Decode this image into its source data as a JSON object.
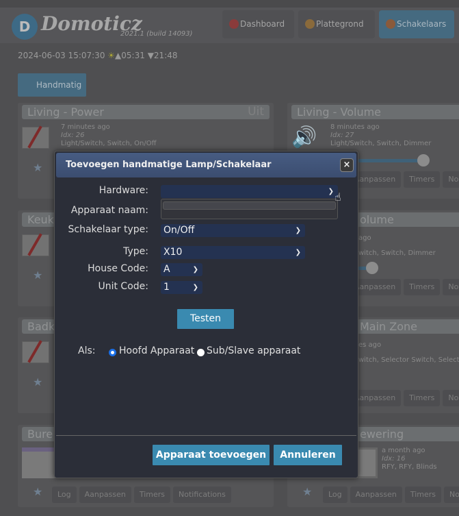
{
  "header": {
    "logo_letter": "D",
    "app_name": "Domoticz",
    "version": "2021.1 (build 14093)",
    "nav": [
      {
        "label": "Dashboard",
        "icon": "star-icon",
        "color": "#8a3b3b"
      },
      {
        "label": "Plattegrond",
        "icon": "floorplan-icon",
        "color": "#8a6a3b"
      },
      {
        "label": "Schakelaars",
        "icon": "bulb-icon",
        "color": "#8a5a3b"
      }
    ]
  },
  "status": {
    "datetime": "2024-06-03 15:07:30",
    "sun_icon": "☀",
    "sunrise": "▲05:31",
    "sunset": "▼21:48"
  },
  "tabs": {
    "manual": "Handmatig"
  },
  "cards": {
    "left": [
      {
        "title": "Living - Power",
        "status": "Uit",
        "time": "7 minutes ago",
        "idx": "Idx: 26",
        "type": "Light/Switch, Switch, On/Off"
      },
      {
        "title": "Keuk"
      },
      {
        "title": "Badk"
      },
      {
        "title": "Bure",
        "buttons": [
          "Log",
          "Aanpassen",
          "Timers",
          "Notifications"
        ]
      }
    ],
    "right": [
      {
        "title": "Living - Volume",
        "time": "8 minutes ago",
        "idx": "Idx: 27",
        "type": "Light/Switch, Switch, Dimmer",
        "buttons": [
          "Aanpassen",
          "Timers",
          "No"
        ]
      },
      {
        "title": "olume",
        "time": "ago",
        "type": "witch, Switch, Dimmer",
        "buttons": [
          "Aanpassen",
          "Timers",
          "No"
        ]
      },
      {
        "title": "Main Zone",
        "time": "es ago",
        "type": "witch, Selector Switch, Selector",
        "buttons": [
          "Aanpassen",
          "Timers",
          "No"
        ]
      },
      {
        "title": "ewering",
        "time": "a month ago",
        "idx": "Idx: 16",
        "type": "RFY, RFY, Blinds",
        "buttons": [
          "Log",
          "Aanpassen",
          "Timers",
          "No"
        ]
      }
    ]
  },
  "modal": {
    "title": "Toevoegen handmatige Lamp/Schakelaar",
    "close": "×",
    "fields": {
      "hardware": {
        "label": "Hardware:",
        "value": ""
      },
      "device_name": {
        "label": "Apparaat naam:",
        "value": ""
      },
      "switch_type": {
        "label": "Schakelaar type:",
        "value": "On/Off"
      },
      "type": {
        "label": "Type:",
        "value": "X10"
      },
      "house_code": {
        "label": "House Code:",
        "value": "A"
      },
      "unit_code": {
        "label": "Unit Code:",
        "value": "1"
      }
    },
    "test_button": "Testen",
    "as_label": "Als:",
    "radio_main": "Hoofd Apparaat",
    "radio_sub": "Sub/Slave apparaat",
    "radio_selected": "main",
    "add_button": "Apparaat toevoegen",
    "cancel_button": "Annuleren"
  }
}
